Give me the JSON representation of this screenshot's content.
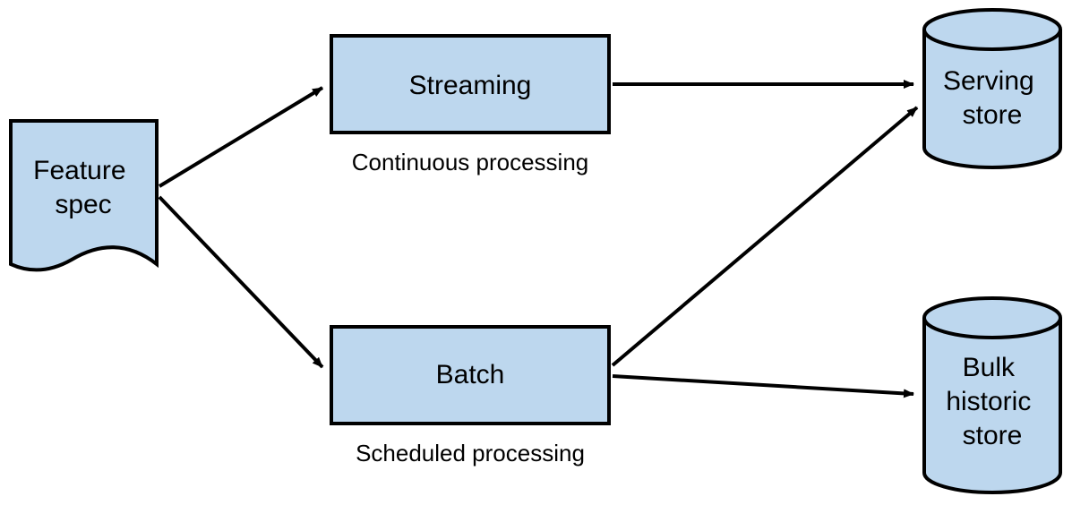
{
  "diagram": {
    "source": {
      "label_line1": "Feature",
      "label_line2": "spec"
    },
    "streaming": {
      "label": "Streaming",
      "caption": "Continuous processing"
    },
    "batch": {
      "label": "Batch",
      "caption": "Scheduled processing"
    },
    "serving_store": {
      "label_line1": "Serving",
      "label_line2": "store"
    },
    "bulk_store": {
      "label_line1": "Bulk",
      "label_line2": "historic",
      "label_line3": "store"
    }
  }
}
